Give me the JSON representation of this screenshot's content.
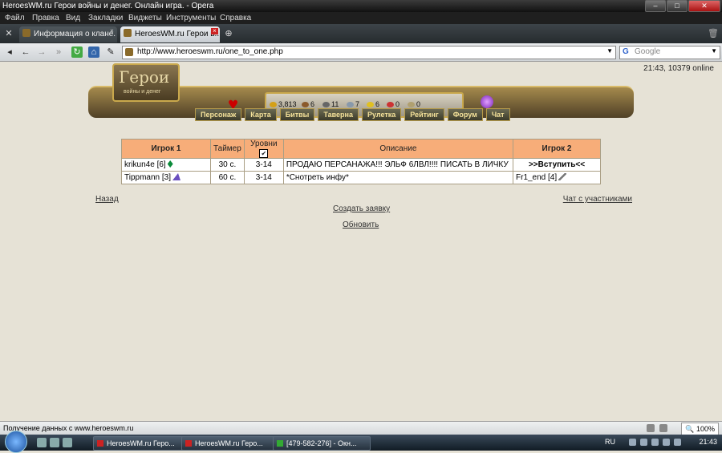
{
  "window": {
    "title": "HeroesWM.ru Герои войны и денег. Онлайн игра. - Opera",
    "controls": [
      "–",
      "□",
      "✕"
    ]
  },
  "menu": [
    "Файл",
    "Правка",
    "Вид",
    "Закладки",
    "Виджеты",
    "Инструменты",
    "Справка"
  ],
  "tabs": [
    {
      "label": "Информация о клане."
    },
    {
      "label": "HeroesWM.ru Герои в..."
    }
  ],
  "address": {
    "url": "http://www.heroeswm.ru/one_to_one.php"
  },
  "search": {
    "placeholder": "Google",
    "engine_glyph": "G"
  },
  "game": {
    "online": "21:43, 10379 online",
    "logo_title": "Герои",
    "logo_subtitle": "войны и денег",
    "resources": [
      {
        "name": "gold",
        "value": "3,813",
        "color": "#d4a017"
      },
      {
        "name": "wood",
        "value": "6",
        "color": "#8b5a2b"
      },
      {
        "name": "ore",
        "value": "11",
        "color": "#666666"
      },
      {
        "name": "mercury",
        "value": "7",
        "color": "#8899aa"
      },
      {
        "name": "sulfur",
        "value": "6",
        "color": "#e0c020"
      },
      {
        "name": "crystals",
        "value": "0",
        "color": "#cc3333"
      },
      {
        "name": "gems",
        "value": "0",
        "color": "#b0a070"
      }
    ],
    "nav": [
      "Персонаж",
      "Карта",
      "Битвы",
      "Таверна",
      "Рулетка",
      "Рейтинг",
      "Форум",
      "Чат"
    ]
  },
  "table": {
    "headers": {
      "player1": "Игрок 1",
      "timer": "Таймер",
      "levels": "Уровни",
      "desc": "Описание",
      "player2": "Игрок 2"
    },
    "levels_check": "✔",
    "rows": [
      {
        "player1": "krikun4e [6]",
        "timer": "30 с.",
        "levels": "3-14",
        "desc": "ПРОДАЮ ПЕРСАНАЖА!!! ЭЛЬФ 6ЛВЛ!!!! ПИСАТЬ В ЛИЧКУ",
        "player2": ">>Вступить<<"
      },
      {
        "player1": "Tippmann [3]",
        "timer": "60 с.",
        "levels": "3-14",
        "desc": "*Снотреть инфу*",
        "player2": "Fr1_end [4]"
      }
    ]
  },
  "links": {
    "back": "Назад",
    "chat": "Чат с участниками",
    "create": "Создать заявку",
    "refresh": "Обновить"
  },
  "status": {
    "text": "Получение данных с www.heroeswm.ru",
    "zoom": "100%"
  },
  "taskbar": {
    "items": [
      {
        "label": "HeroesWM.ru Геро..."
      },
      {
        "label": "HeroesWM.ru Геро..."
      },
      {
        "label": "[479-582-276] - Окн..."
      }
    ],
    "lang": "RU",
    "clock": "21:43"
  }
}
